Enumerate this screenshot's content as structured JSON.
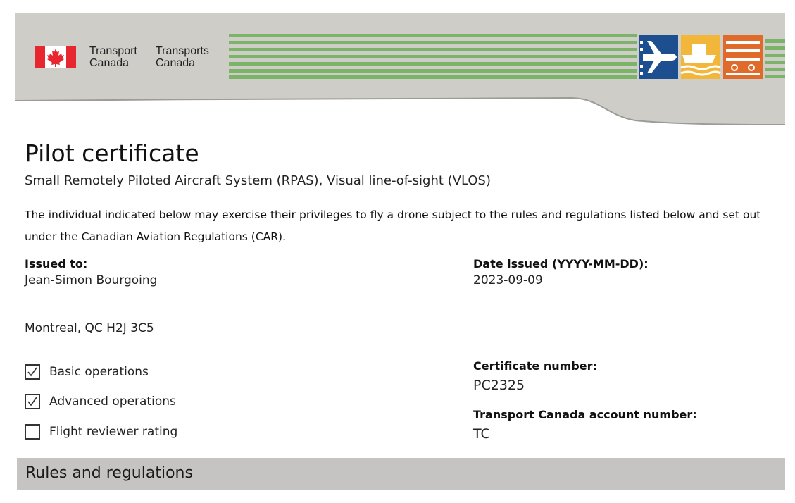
{
  "header": {
    "department_en": "Transport\nCanada",
    "department_fr": "Transports\nCanada",
    "flag_icon": "canada-flag-icon",
    "mode_icons": [
      "aviation-icon",
      "marine-icon",
      "rail-icon"
    ],
    "colors": {
      "banner_bg": "#cfcdc8",
      "stripe_green": "#7bb369",
      "flag_red": "#e8262f",
      "aviation_blue": "#1d4e8f",
      "marine_yellow": "#f2b63a",
      "rail_orange": "#e06a2a"
    }
  },
  "certificate": {
    "title": "Pilot certificate",
    "subtitle": "Small Remotely Piloted Aircraft System (RPAS), Visual line-of-sight (VLOS)",
    "intro": "The individual indicated below may exercise their privileges to fly a drone subject to the rules and regulations listed below and set out under the Canadian Aviation Regulations (CAR)."
  },
  "issued_to": {
    "label": "Issued to:",
    "name": "Jean-Simon Bourgoing",
    "address": "Montreal, QC H2J 3C5"
  },
  "date_issued": {
    "label": "Date issued (YYYY-MM-DD):",
    "value": "2023-09-09"
  },
  "certificate_number": {
    "label": "Certificate number:",
    "value": "PC2325"
  },
  "account_number": {
    "label": "Transport Canada account number:",
    "value": "TC"
  },
  "ratings": [
    {
      "label": "Basic operations",
      "checked": true
    },
    {
      "label": "Advanced operations",
      "checked": true
    },
    {
      "label": "Flight reviewer rating",
      "checked": false
    }
  ],
  "rules_section": {
    "title": "Rules and regulations"
  }
}
